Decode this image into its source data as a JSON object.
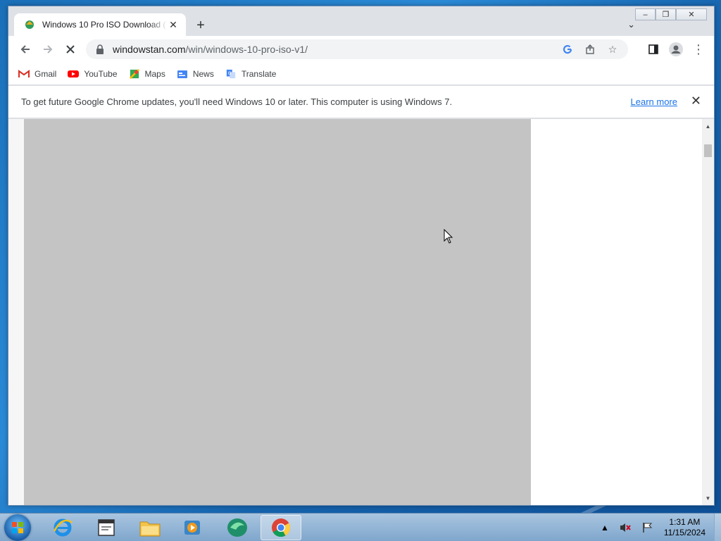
{
  "browser": {
    "tab": {
      "title": "Windows 10 Pro ISO Download ("
    },
    "address": {
      "host": "windowstan.com",
      "path": "/win/windows-10-pro-iso-v1/"
    },
    "bookmarks": [
      {
        "label": "Gmail",
        "icon": "gmail-icon"
      },
      {
        "label": "YouTube",
        "icon": "youtube-icon"
      },
      {
        "label": "Maps",
        "icon": "maps-icon"
      },
      {
        "label": "News",
        "icon": "news-icon"
      },
      {
        "label": "Translate",
        "icon": "translate-icon"
      }
    ],
    "infobar": {
      "message": "To get future Google Chrome updates, you'll need Windows 10 or later. This computer is using Windows 7.",
      "link": "Learn more"
    }
  },
  "taskbar": {
    "clock": {
      "time": "1:31 AM",
      "date": "11/15/2024"
    },
    "items": [
      "internet-explorer-icon",
      "window-app-icon",
      "file-explorer-icon",
      "media-player-icon",
      "green-app-icon",
      "chrome-icon"
    ]
  },
  "colors": {
    "accent": "#1a73e8",
    "page_gray": "#c4c4c4"
  }
}
